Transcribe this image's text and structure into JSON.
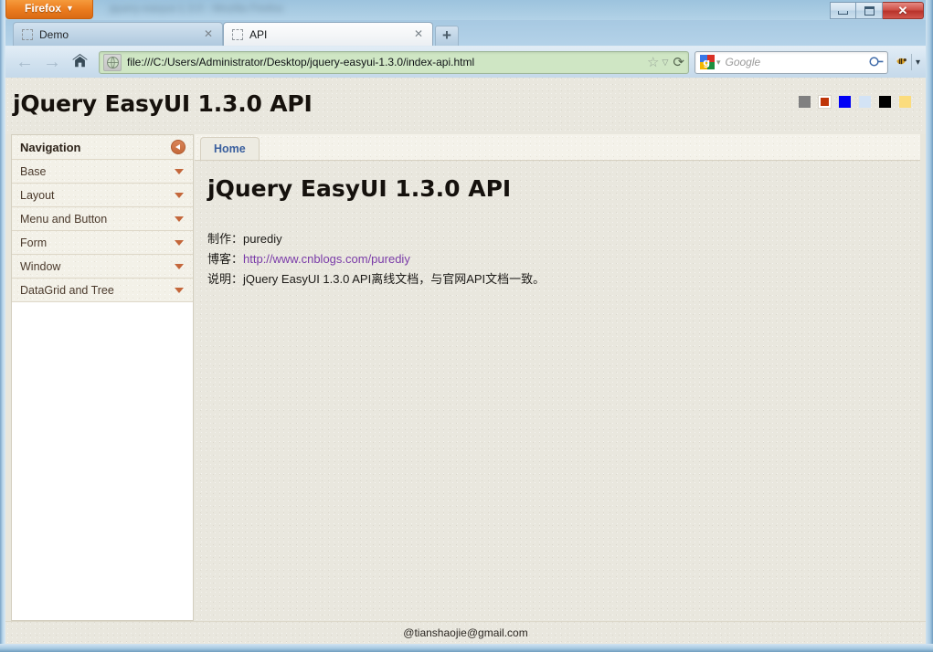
{
  "window": {
    "title_bar_blurred_text": "jquery-easyui-1.3.0 - Mozilla Firefox",
    "app_button_label": "Firefox",
    "app_button_caret": "▼",
    "controls": {
      "minimize": "minimize-glyph",
      "maximize": "maximize-glyph",
      "close": "✕"
    }
  },
  "browser": {
    "tabs": [
      {
        "title": "Demo",
        "favicon": "blank-favicon",
        "close": "✕",
        "active": false
      },
      {
        "title": "API",
        "favicon": "blank-favicon",
        "close": "✕",
        "active": true
      }
    ],
    "new_tab_label": "+",
    "toolbar": {
      "back_glyph": "←",
      "forward_glyph": "→",
      "home_glyph": "⌂",
      "identity_icon": "globe-icon",
      "url": "file:///C:/Users/Administrator/Desktop/jquery-easyui-1.3.0/index-api.html",
      "bookmark_star": "☆",
      "bookmark_caret": "▽",
      "reload_glyph": "⟳",
      "search_engine": "google-logo",
      "search_engine_caret": "▾",
      "search_placeholder": "Google",
      "search_submit": "⚲",
      "extension_icon": "bee-icon",
      "overflow_caret": "▾"
    }
  },
  "page": {
    "header": {
      "title": "jQuery EasyUI 1.3.0 API",
      "swatches": [
        {
          "name": "gray",
          "color": "#808080",
          "selected": false
        },
        {
          "name": "orange-red",
          "color": "#bf3508",
          "selected": true
        },
        {
          "name": "blue",
          "color": "#0000f5",
          "selected": false
        },
        {
          "name": "light-blue",
          "color": "#d3e3f5",
          "selected": false
        },
        {
          "name": "black",
          "color": "#000000",
          "selected": false
        },
        {
          "name": "gold",
          "color": "#fbdc7d",
          "selected": false
        }
      ]
    },
    "sidebar": {
      "nav_title": "Navigation",
      "collapse_icon": "collapse-left-icon",
      "items": [
        {
          "label": "Base",
          "arrow": "chevron-down-icon"
        },
        {
          "label": "Layout",
          "arrow": "chevron-down-icon"
        },
        {
          "label": "Menu and Button",
          "arrow": "chevron-down-icon"
        },
        {
          "label": "Form",
          "arrow": "chevron-down-icon"
        },
        {
          "label": "Window",
          "arrow": "chevron-down-icon"
        },
        {
          "label": "DataGrid and Tree",
          "arrow": "chevron-down-icon"
        }
      ]
    },
    "main": {
      "tab_label": "Home",
      "doc_title": "jQuery EasyUI 1.3.0 API",
      "lines": [
        {
          "label": "制作：",
          "text": "purediy",
          "link": null
        },
        {
          "label": "博客：",
          "text": "",
          "link": "http://www.cnblogs.com/purediy"
        },
        {
          "label": "说明：",
          "text": "jQuery EasyUI 1.3.0 API离线文档，与官网API文档一致。",
          "link": null
        }
      ]
    },
    "footer": {
      "text": "@tianshaojie@gmail.com"
    }
  },
  "colors": {
    "accent_orange": "#c4673b",
    "page_bg": "#e9e7de",
    "tab_text_blue": "#3a5f9e",
    "link_purple": "#7a3ba8",
    "url_bar_green": "#cfe6c4"
  }
}
